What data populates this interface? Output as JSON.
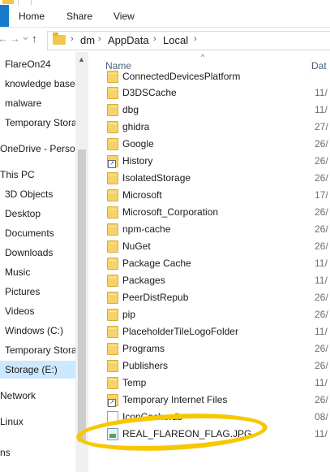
{
  "ribbon": {
    "tabs": [
      "Home",
      "Share",
      "View"
    ]
  },
  "address": {
    "back_glyph": "←",
    "forward_glyph": "→",
    "recent_glyph": "⌄",
    "up_glyph": "↑",
    "separator": "›",
    "crumbs": [
      "dm",
      "AppData",
      "Local"
    ]
  },
  "navpane": {
    "items": [
      {
        "label": "FlareOn24"
      },
      {
        "label": "knowledge base"
      },
      {
        "label": "malware"
      },
      {
        "label": "Temporary Stora"
      },
      {
        "label": "OneDrive - Persor"
      },
      {
        "label": "This PC"
      },
      {
        "label": "3D Objects"
      },
      {
        "label": "Desktop"
      },
      {
        "label": "Documents"
      },
      {
        "label": "Downloads"
      },
      {
        "label": "Music"
      },
      {
        "label": "Pictures"
      },
      {
        "label": "Videos"
      },
      {
        "label": "Windows (C:)"
      },
      {
        "label": "Temporary Stora"
      },
      {
        "label": "Storage (E:)"
      },
      {
        "label": "Network"
      },
      {
        "label": "Linux"
      },
      {
        "label": "ns"
      }
    ]
  },
  "content": {
    "sort_glyph": "^",
    "columns": {
      "name": "Name",
      "date": "Dat"
    },
    "files": [
      {
        "name": "ConnectedDevicesPlatform",
        "date": "",
        "icon": "folder-icon"
      },
      {
        "name": "D3DSCache",
        "date": "11/",
        "icon": "folder-icon"
      },
      {
        "name": "dbg",
        "date": "11/",
        "icon": "folder-icon"
      },
      {
        "name": "ghidra",
        "date": "27/",
        "icon": "folder-icon"
      },
      {
        "name": "Google",
        "date": "26/",
        "icon": "folder-icon"
      },
      {
        "name": "History",
        "date": "26/",
        "icon": "shortcut-folder-icon"
      },
      {
        "name": "IsolatedStorage",
        "date": "26/",
        "icon": "folder-icon"
      },
      {
        "name": "Microsoft",
        "date": "17/",
        "icon": "folder-icon"
      },
      {
        "name": "Microsoft_Corporation",
        "date": "26/",
        "icon": "folder-icon"
      },
      {
        "name": "npm-cache",
        "date": "26/",
        "icon": "folder-icon"
      },
      {
        "name": "NuGet",
        "date": "26/",
        "icon": "folder-icon"
      },
      {
        "name": "Package Cache",
        "date": "11/",
        "icon": "folder-icon"
      },
      {
        "name": "Packages",
        "date": "11/",
        "icon": "folder-icon"
      },
      {
        "name": "PeerDistRepub",
        "date": "26/",
        "icon": "folder-icon"
      },
      {
        "name": "pip",
        "date": "26/",
        "icon": "folder-icon"
      },
      {
        "name": "PlaceholderTileLogoFolder",
        "date": "11/",
        "icon": "folder-icon"
      },
      {
        "name": "Programs",
        "date": "26/",
        "icon": "folder-icon"
      },
      {
        "name": "Publishers",
        "date": "26/",
        "icon": "folder-icon"
      },
      {
        "name": "Temp",
        "date": "11/",
        "icon": "folder-icon"
      },
      {
        "name": "Temporary Internet Files",
        "date": "26/",
        "icon": "shortcut-folder-icon"
      },
      {
        "name": "IconCache.db",
        "date": "08/",
        "icon": "file-icon"
      },
      {
        "name": "REAL_FLAREON_FLAG.JPG",
        "date": "11/",
        "icon": "image-file-icon"
      }
    ]
  },
  "annotation": {
    "color": "#f7c800"
  }
}
